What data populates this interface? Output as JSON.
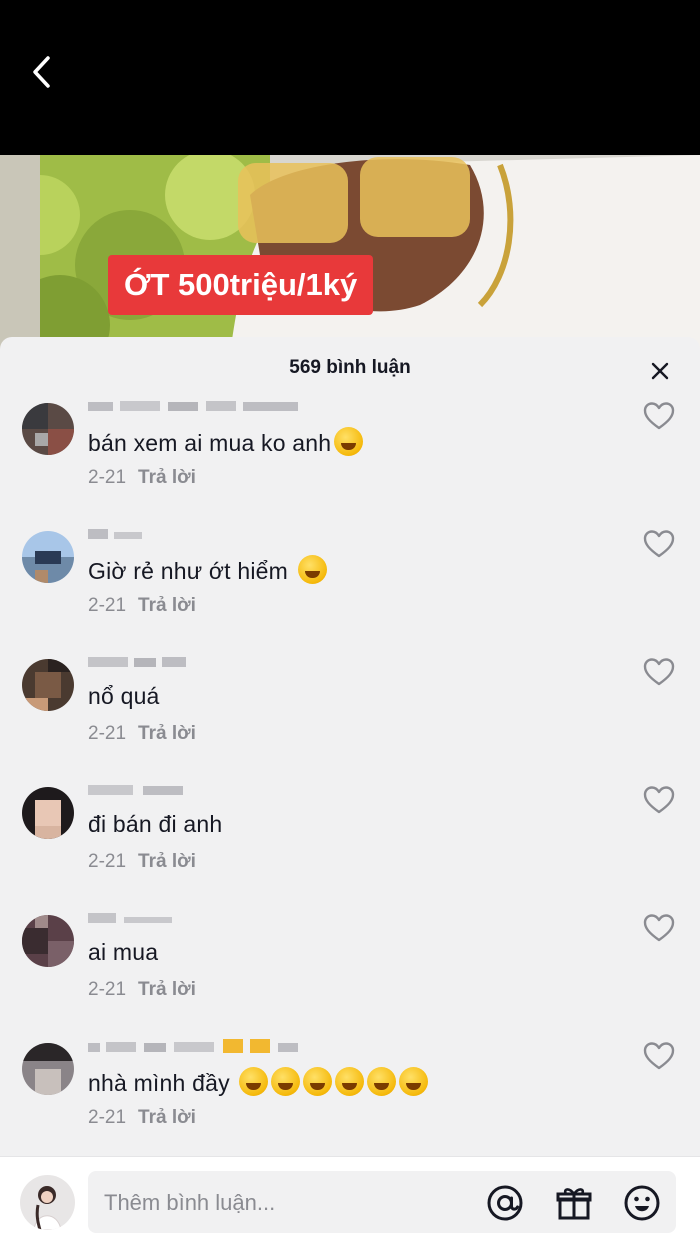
{
  "video": {
    "caption": "ỚT 500triệu/1ký"
  },
  "comments_sheet": {
    "title": "569 bình luận",
    "comments": [
      {
        "text": "bán xem ai mua ko anh",
        "emojis": [
          "rofl"
        ],
        "date": "2-21",
        "reply_label": "Trả lời"
      },
      {
        "text": "Giờ rẻ như ớt hiểm ",
        "emojis": [
          "joy"
        ],
        "date": "2-21",
        "reply_label": "Trả lời"
      },
      {
        "text": "nổ quá",
        "emojis": [],
        "date": "2-21",
        "reply_label": "Trả lời"
      },
      {
        "text": "đi bán đi anh",
        "emojis": [],
        "date": "2-21",
        "reply_label": "Trả lời"
      },
      {
        "text": "ai mua",
        "emojis": [],
        "date": "2-21",
        "reply_label": "Trả lời"
      },
      {
        "text": "nhà mình đầy ",
        "emojis": [
          "sweat-smile",
          "sweat-smile",
          "sweat-smile",
          "sweat-smile",
          "sweat-smile",
          "sweat-smile"
        ],
        "date": "2-21",
        "reply_label": "Trả lời"
      }
    ]
  },
  "composer": {
    "placeholder": "Thêm bình luận...",
    "icons": [
      "at-icon",
      "gift-icon",
      "emoji-icon"
    ]
  },
  "colors": {
    "caption_bg": "#e8393a",
    "sheet_bg": "#f1f1f2",
    "text": "#161823",
    "muted": "#8a8b91"
  }
}
